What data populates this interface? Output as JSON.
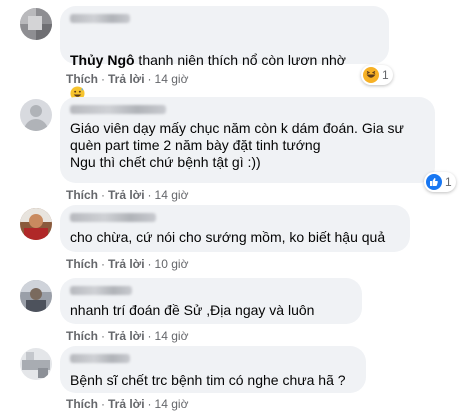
{
  "comments": [
    {
      "mention": "Thủy Ngô",
      "text": " thanh niên thích nổ còn lươn nhờ",
      "like_label": "Thích",
      "reply_label": "Trả lời",
      "time": "14 giờ",
      "reaction_icon": "haha-emoji",
      "reaction_count": "1",
      "accent": "#f7b125"
    },
    {
      "text": "Giáo viên dạy mấy chục năm còn k dám đoán. Gia sư quèn part time 2 năm bày đặt tinh tướng\nNgu thì chết chứ bệnh tật gì :))",
      "like_label": "Thích",
      "reply_label": "Trả lời",
      "time": "14 giờ",
      "reaction_icon": "like-thumb",
      "reaction_count": "1",
      "accent": "#1877f2"
    },
    {
      "text": "cho chừa, cứ nói cho sướng mồm, ko biết hậu quả",
      "like_label": "Thích",
      "reply_label": "Trả lời",
      "time": "10 giờ"
    },
    {
      "text": "nhanh trí đoán đề Sử ,Địa ngay và luôn",
      "like_label": "Thích",
      "reply_label": "Trả lời",
      "time": "14 giờ"
    },
    {
      "text": "Bệnh sĩ chết trc bệnh tim có nghe chưa hã ?",
      "like_label": "Thích",
      "reply_label": "Trả lời",
      "time": "14 giờ"
    }
  ],
  "separator": "·"
}
